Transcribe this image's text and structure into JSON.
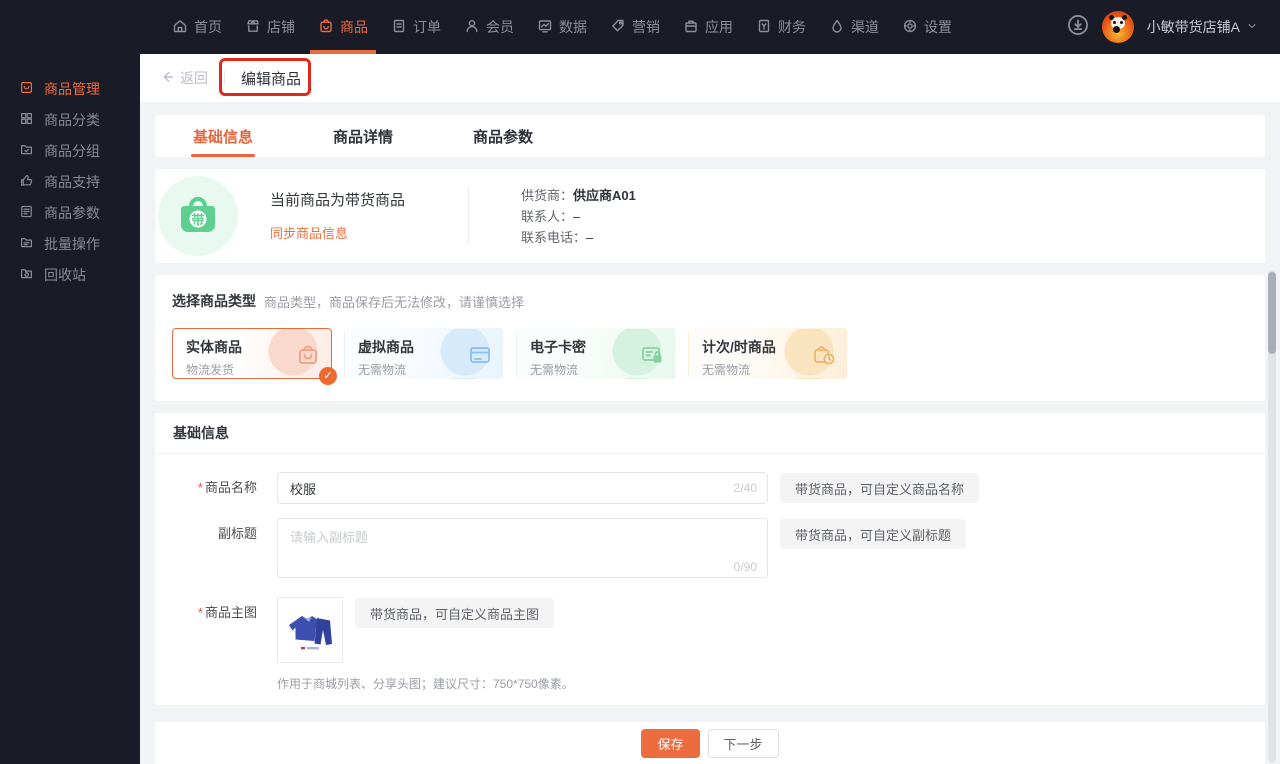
{
  "colors": {
    "accent": "#ec6b3f",
    "nav_bg": "#191c27",
    "green": "#5ecf90",
    "annotation_red": "#de2a1e"
  },
  "topnav": {
    "items": [
      {
        "label": "首页",
        "icon": "home-icon",
        "active": false
      },
      {
        "label": "店铺",
        "icon": "shop-icon",
        "active": false
      },
      {
        "label": "商品",
        "icon": "product-icon",
        "active": true
      },
      {
        "label": "订单",
        "icon": "order-icon",
        "active": false
      },
      {
        "label": "会员",
        "icon": "member-icon",
        "active": false
      },
      {
        "label": "数据",
        "icon": "data-icon",
        "active": false
      },
      {
        "label": "营销",
        "icon": "marketing-icon",
        "active": false
      },
      {
        "label": "应用",
        "icon": "apps-icon",
        "active": false
      },
      {
        "label": "财务",
        "icon": "finance-icon",
        "active": false
      },
      {
        "label": "渠道",
        "icon": "channel-icon",
        "active": false
      },
      {
        "label": "设置",
        "icon": "settings-icon",
        "active": false
      }
    ],
    "store_name": "小敏带货店铺A"
  },
  "sidebar": {
    "items": [
      {
        "label": "商品管理",
        "icon": "goods-manage-icon",
        "active": true
      },
      {
        "label": "商品分类",
        "icon": "category-grid-icon",
        "active": false
      },
      {
        "label": "商品分组",
        "icon": "group-folder-icon",
        "active": false
      },
      {
        "label": "商品支持",
        "icon": "thumbs-up-icon",
        "active": false
      },
      {
        "label": "商品参数",
        "icon": "params-doc-icon",
        "active": false
      },
      {
        "label": "批量操作",
        "icon": "batch-folder-icon",
        "active": false
      },
      {
        "label": "回收站",
        "icon": "recycle-folder-icon",
        "active": false
      }
    ]
  },
  "header": {
    "back_label": "返回",
    "title": "编辑商品"
  },
  "tabs": [
    {
      "label": "基础信息",
      "active": true
    },
    {
      "label": "商品详情",
      "active": false
    },
    {
      "label": "商品参数",
      "active": false
    }
  ],
  "info_card": {
    "badge_char": "带",
    "title": "当前商品为带货商品",
    "sync_link": "同步商品信息",
    "rows": [
      {
        "label": "供货商：",
        "value": "供应商A01"
      },
      {
        "label": "联系人：",
        "value": "–"
      },
      {
        "label": "联系电话：",
        "value": "–"
      }
    ]
  },
  "type_section": {
    "title": "选择商品类型",
    "hint": "商品类型，商品保存后无法修改，请谨慎选择",
    "options": [
      {
        "name": "实体商品",
        "sub": "物流发货",
        "icon": "physical-bag-icon",
        "selected": true
      },
      {
        "name": "虚拟商品",
        "sub": "无需物流",
        "icon": "virtual-window-icon",
        "selected": false
      },
      {
        "name": "电子卡密",
        "sub": "无需物流",
        "icon": "card-lock-icon",
        "selected": false
      },
      {
        "name": "计次/时商品",
        "sub": "无需物流",
        "icon": "bag-clock-icon",
        "selected": false
      }
    ],
    "check_glyph": "✓"
  },
  "basic_section": {
    "title": "基础信息",
    "name_field": {
      "label": "商品名称",
      "required": true,
      "value": "校服",
      "counter": "2/40",
      "tag": "带货商品，可自定义商品名称"
    },
    "subtitle_field": {
      "label": "副标题",
      "placeholder": "请输入副标题",
      "counter": "0/90",
      "tag": "带货商品，可自定义副标题"
    },
    "image_field": {
      "label": "商品主图",
      "required": true,
      "tag": "带货商品，可自定义商品主图",
      "hint": "作用于商城列表、分享头图；建议尺寸：750*750像素。"
    }
  },
  "footer": {
    "save_label": "保存",
    "next_label": "下一步"
  }
}
